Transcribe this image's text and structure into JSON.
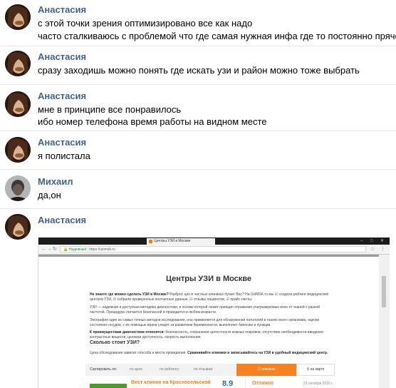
{
  "messages": [
    {
      "author": "Анастасия",
      "lines": [
        "с этой точки зрения оптимизировано все как надо",
        "часто сталкиваюсь с проблемой что где самая нужная инфа где то постоянно прячется"
      ]
    },
    {
      "author": "Анастасия",
      "lines": [
        "сразу заходишь можно понять где искать узи и район можно тоже выбрать"
      ]
    },
    {
      "author": "Анастасия",
      "lines": [
        "мне в принципе все понравилось",
        "ибо номер телефона время работы на видном месте"
      ]
    },
    {
      "author": "Анастасия",
      "lines": [
        "я полистала"
      ]
    },
    {
      "author": "Михаил",
      "lines": [
        "да,он"
      ]
    },
    {
      "author": "Анастасия",
      "lines": []
    }
  ],
  "screenshot": {
    "tab_title": "Центры УЗИ в Москве",
    "url_secure": "Надежный",
    "url": "https://uzimsk.ru",
    "page_title": "Центры УЗИ в Москве",
    "intro_bold": "Не знаете где можно сделать УЗИ в Москве?",
    "intro_rest": " Разброс цен в частных клиниках пугает Вас? На UziMSK.ru мы ☑ создали рейтинг медицинских центров УЗИ, ☑ собрали проверенные контактные данные, ☑ отзывы пациентов, ☑ прайс-листы.",
    "para2": "УЗИ — надежная и доступная методика диагностики, в основе которой лежит принцип отражения ультразвуковых волн от тканей с разной частотой. Процедура считается безопасной и проводится в любом возрасте.",
    "para3": "Эхография один из самых точных методов исследования, она применяется для обнаружения патологий в тканях всего организма, оценки состояния сосудов, с ее помощью врачи следят за развитием беременности, выполняют биопсию и пункции.",
    "adv_bold": "К преимуществам диагностики относятся:",
    "adv_rest": " безопасность, сохранение целостности кожных покровов, отсутствие необходимости введения контрастных веществ, ценовая доступность, скорость выполнения.",
    "price_heading": "Сколько стоит УЗИ?",
    "price_text": "Цена обследования зависит способа и места проведения.",
    "price_bold": " Сравнивайте клиники и записывайтесь на УЗИ в удобный медицинский центр.",
    "sort_label": "Сортировать по:",
    "sort_options": [
      "по цене",
      "по рейтингу",
      "по отзывам"
    ],
    "list_button": "списком",
    "map_button": "на карте",
    "clinic_name": "Вест клиник на Красносельской",
    "clinic_score": "8.9",
    "review_label": "Отлично",
    "review_date": "23 октября 2016 г."
  }
}
